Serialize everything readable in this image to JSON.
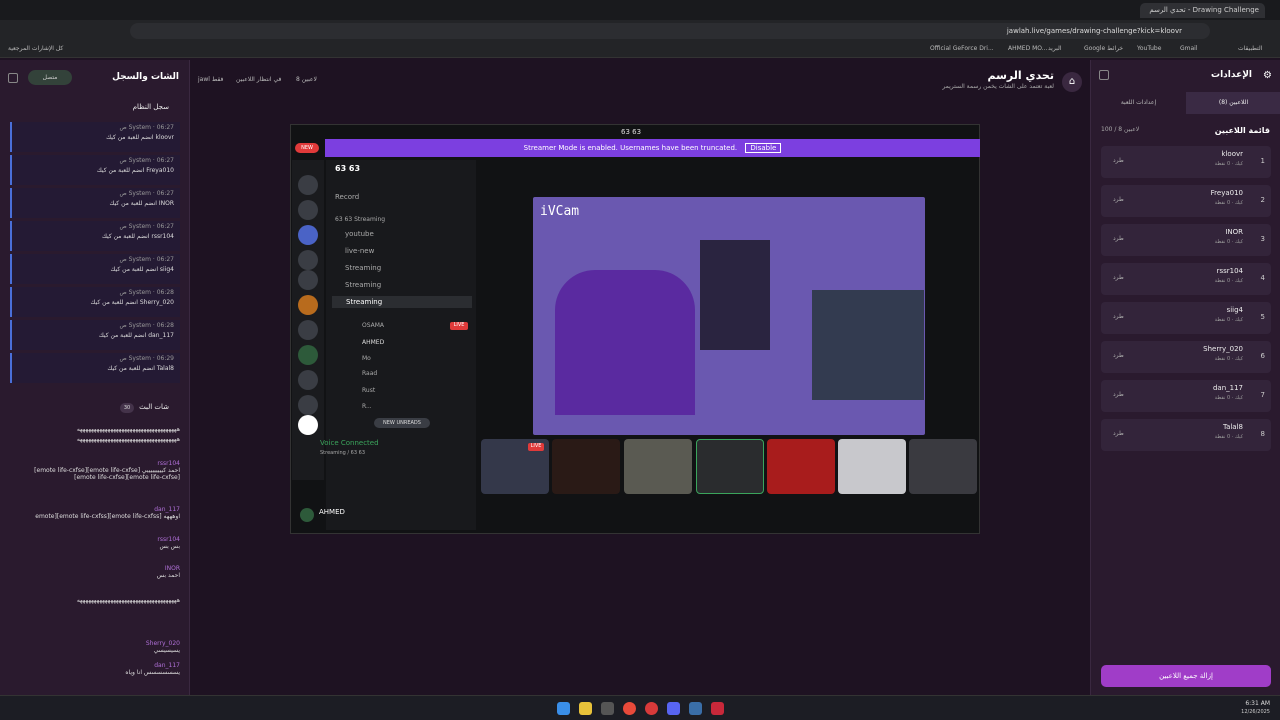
{
  "browser": {
    "tab_title": "Drawing Challenge - تحدي الرسم",
    "url": "jawlah.live/games/drawing-challenge?kick=kloovr",
    "bookmarks": [
      "Official GeForce Dri...",
      "AHMED MO...",
      "البريد",
      "Google خرائط",
      "YouTube",
      "Gmail",
      "التطبيقات",
      "كل الإشارات المرجعية"
    ]
  },
  "left": {
    "title": "الشات والسجل",
    "status": "متصل",
    "system_log_title": "سجل النظام",
    "system_log": [
      {
        "meta": "System · 06:27 ص",
        "text": "kloovr انضم للعبة من كيك"
      },
      {
        "meta": "System · 06:27 ص",
        "text": "Freya010 انضم للعبة من كيك"
      },
      {
        "meta": "System · 06:27 ص",
        "text": "INOR انضم للعبة من كيك"
      },
      {
        "meta": "System · 06:27 ص",
        "text": "rssr104 انضم للعبة من كيك"
      },
      {
        "meta": "System · 06:27 ص",
        "text": "siig4 انضم للعبة من كيك"
      },
      {
        "meta": "System · 06:28 ص",
        "text": "Sherry_020 انضم للعبة من كيك"
      },
      {
        "meta": "System · 06:28 ص",
        "text": "dan_117 انضم للعبة من كيك"
      },
      {
        "meta": "System · 06:29 ص",
        "text": "Talal8 انضم للعبة من كيك"
      }
    ],
    "live_chat_title": "شات البث",
    "live_chat_count": "30",
    "chat": [
      {
        "name": "",
        "text": "ههههههههههههههههههههههههههههههههههههه"
      },
      {
        "name": "",
        "text": "ههههههههههههههههههههههههههههههههههههه"
      },
      {
        "name": "rssr104",
        "text": "احمد كيييييييييي [emote life-cxfse][emote life-cxfse][emote life-cxfse][emote life-cxfse]"
      },
      {
        "name": "dan_117",
        "text": "اوهههه [emote life-cxfss][emote life-cxfss][emote"
      },
      {
        "name": "rssr104",
        "text": "بس بس"
      },
      {
        "name": "INOR",
        "text": "احمد بس"
      },
      {
        "name": "",
        "text": "ههههههههههههههههههههههههههههههههههههه"
      },
      {
        "name": "Sherry_020",
        "text": "يسيسيسي"
      },
      {
        "name": "dan_117",
        "text": "يسسسسسس انا وياه"
      }
    ]
  },
  "header": {
    "title": "تحدي الرسم",
    "subtitle": "لعبة تعتمد على الشات يخمن رسمة الستريمر",
    "players": "8 لاعبين",
    "waiting": "في انتظار اللاعبين",
    "mode": "jawl فقط"
  },
  "discord": {
    "window_title": "63 63",
    "server": "63 63",
    "streamer_mode": "Streamer Mode is enabled. Usernames have been truncated.",
    "disable": "Disable",
    "new_badge": "NEW",
    "channels": [
      "Record",
      "63 63 Streaming",
      "youtube",
      "live-new",
      "Streaming",
      "Streaming",
      "Streaming"
    ],
    "members": [
      "OSAMA",
      "AHMED",
      "Mo",
      "Raad",
      "Rust",
      "R..."
    ],
    "live": "LIVE",
    "new_unreads": "NEW UNREADS",
    "voice_connected": "Voice Connected",
    "voice_channel": "Streaming / 63 63",
    "user": "AHMED",
    "cam_label": "iVCam"
  },
  "right": {
    "title": "الإعدادات",
    "tab_players": "اللاعبين (8)",
    "tab_settings": "إعدادات اللعبة",
    "list_title": "قائمة اللاعبين",
    "count": "100 / 8 لاعبين",
    "kick_label": "طرد",
    "points": "كيك · 0 نقطة",
    "players": [
      "kloovr",
      "Freya010",
      "INOR",
      "rssr104",
      "siig4",
      "Sherry_020",
      "dan_117",
      "Talal8"
    ],
    "remove_all": "إزالة جميع اللاعبين"
  },
  "taskbar": {
    "time": "6:31 AM",
    "date": "12/26/2025"
  }
}
